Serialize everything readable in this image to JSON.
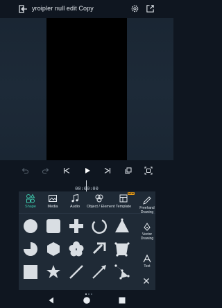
{
  "header": {
    "title": "yroipler null edit  Copy",
    "icons": [
      "back-icon",
      "gear-icon",
      "share-icon"
    ]
  },
  "playback": {
    "timecode": "00:00:00",
    "icons": [
      "undo-icon",
      "redo-icon",
      "skip-to-start-icon",
      "play-icon",
      "skip-to-end-icon",
      "copy-frame-icon",
      "fit-screen-icon"
    ]
  },
  "panel": {
    "tabs": [
      {
        "label": "Shape",
        "icon": "shapes-icon",
        "active": true
      },
      {
        "label": "Media",
        "icon": "image-icon",
        "active": false
      },
      {
        "label": "Audio",
        "icon": "music-note-icon",
        "active": false
      },
      {
        "label": "Object / Element",
        "icon": "object-element-icon",
        "active": false
      },
      {
        "label": "Template",
        "icon": "template-icon",
        "active": false,
        "badge": "NEW"
      }
    ],
    "side": [
      {
        "label": "Freehand Drawing",
        "icon": "pen-icon"
      },
      {
        "label": "Vector Drawing",
        "icon": "vector-pen-icon"
      },
      {
        "label": "Text",
        "icon": "text-icon"
      }
    ],
    "shapes": [
      "circle-shape",
      "rounded-square-shape",
      "plus-shape",
      "arc-shape",
      "triangle-shape",
      "pie-shape",
      "hexagon-shape",
      "flower-shape",
      "arrow-shape",
      "trapezoid-shape",
      "square-shape",
      "star-shape",
      "line-shape",
      "arrow-line-shape",
      "bezier-shape"
    ],
    "page_indicator": {
      "pages": 3,
      "current": 1
    }
  },
  "colors": {
    "accent": "#3ec9ad",
    "background": "#0f1620",
    "panel": "#1f2a36",
    "badge": "#f0a21b"
  },
  "nav": [
    "back-triangle-icon",
    "home-circle-icon",
    "recents-square-icon"
  ]
}
